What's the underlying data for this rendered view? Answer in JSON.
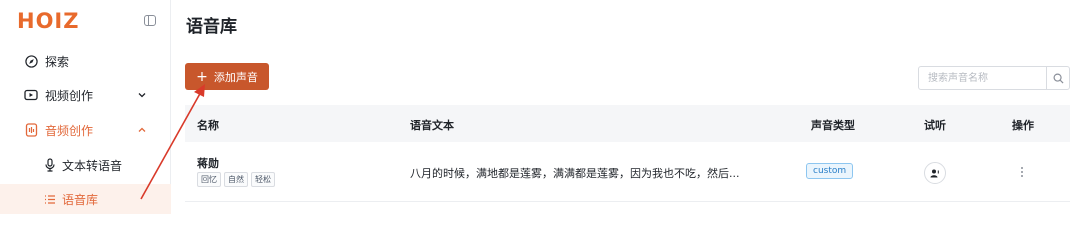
{
  "brand": {
    "logo_text": "HOIZ",
    "accent": "#e86a2c"
  },
  "sidebar": {
    "items": [
      {
        "label": "探索",
        "icon": "compass-icon"
      },
      {
        "label": "视频创作",
        "icon": "video-icon",
        "expanded": false
      },
      {
        "label": "音频创作",
        "icon": "audio-icon",
        "expanded": true,
        "active": true
      },
      {
        "label": "文本转语音",
        "icon": "microphone-icon"
      },
      {
        "label": "语音库",
        "icon": "list-icon",
        "active": true
      }
    ]
  },
  "main": {
    "title": "语音库",
    "add_button": "添加声音",
    "search": {
      "placeholder": "搜索声音名称",
      "value": ""
    },
    "table": {
      "columns": [
        "名称",
        "语音文本",
        "声音类型",
        "试听",
        "操作"
      ],
      "rows": [
        {
          "name": "蒋勋",
          "tags": [
            "回忆",
            "自然",
            "轻松"
          ],
          "text": "八月的时候，满地都是莲雾，满满都是莲雾，因为我也不吃，然后...",
          "type": "custom"
        }
      ]
    }
  },
  "colors": {
    "primary_button": "#c8572c",
    "active_bg": "#fdf1eb",
    "active_text": "#e2683a",
    "annotation_arrow": "#d93a2a"
  }
}
